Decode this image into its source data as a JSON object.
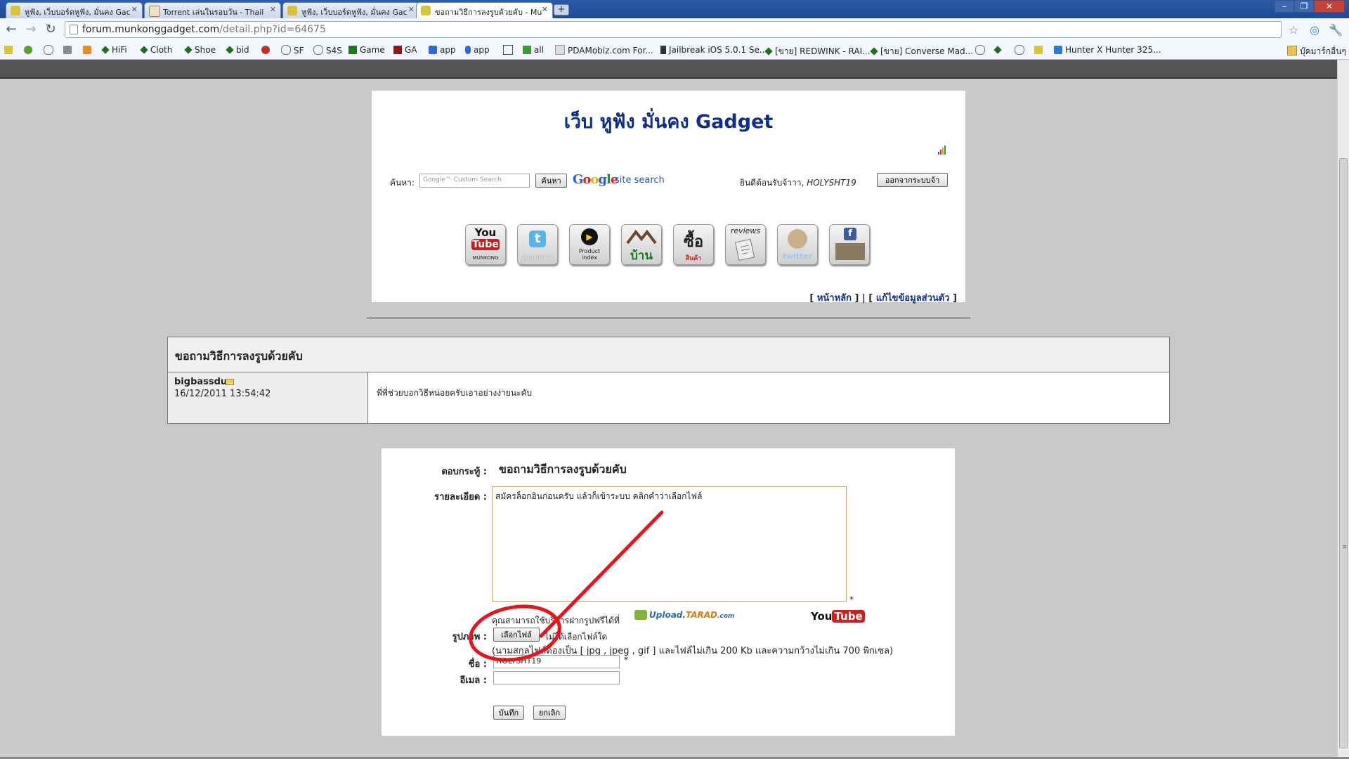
{
  "browser": {
    "tabs": [
      {
        "title": "หูฟัง, เว็บบอร์ดหูฟัง, มั่นคง Gac",
        "active": false
      },
      {
        "title": "Torrent เล่นในรอบวัน - Thail",
        "active": false
      },
      {
        "title": "หูฟัง, เว็บบอร์ดหูฟัง, มั่นคง Gac",
        "active": false
      },
      {
        "title": "ขอถามวิธีการลงรูบด้วยคับ - Mu",
        "active": true
      }
    ],
    "new_tab": "+",
    "url_host": "forum.munkonggadget.com",
    "url_path": "/detail.php?id=64675",
    "bookmarks": [
      "HiFi",
      "Cloth",
      "Shoe",
      "bid",
      "SF",
      "S4S",
      "Game",
      "GA",
      "app",
      "app",
      "all",
      "PDAMobiz.com For...",
      "Jailbreak iOS 5.0.1 Se...",
      "[ขาย] REDWINK - RAI...",
      "[ขาย] Converse Mad...",
      "Hunter X Hunter 325..."
    ],
    "other_bookmarks": "บุ๊คมาร์กอื่นๆ"
  },
  "header": {
    "site_title": "เว็บ หูฟัง มั่นคง Gadget",
    "search_label": "ค้นหา:",
    "search_placeholder": "Google™ Custom Search",
    "search_button": "ค้นหา",
    "google_text": "Google",
    "site_search_text": "site search",
    "welcome_text": "ยินดีต้อนรับจ้าาา,",
    "username": "HOLYSHT19",
    "logout_button": "ออกจากระบบจ้า",
    "nav_icons": [
      {
        "name": "youtube-munkong",
        "line1": "You",
        "line2": "Tube",
        "line3": "MUNKONG"
      },
      {
        "name": "twitter-update",
        "line1": "t",
        "line2": "",
        "line3": "อัพเดทสินค้า"
      },
      {
        "name": "product-index",
        "line1": "▶",
        "line2": "Product",
        "line3": "index"
      },
      {
        "name": "home",
        "line1": "",
        "line2": "บ้าน",
        "line3": ""
      },
      {
        "name": "buy",
        "line1": "ซื้อ",
        "line2": "สินค้า",
        "line3": ""
      },
      {
        "name": "reviews",
        "line1": "reviews",
        "line2": "",
        "line3": ""
      },
      {
        "name": "twitter",
        "line1": "",
        "line2": "",
        "line3": "twitter"
      },
      {
        "name": "facebook",
        "line1": "f",
        "line2": "",
        "line3": ""
      }
    ],
    "links": {
      "home": "หน้าหลัก",
      "edit_profile": "แก้ไขข้อมูลส่วนตัว"
    }
  },
  "topic": {
    "title": "ขอถามวิธีการลงรูบด้วยคับ",
    "author": "bigbassdu",
    "date": "16/12/2011 13:54:42",
    "body": "พี่พี่ช่วยบอกวิธีหน่อยครับเอาอย่างง่ายนะคับ"
  },
  "reply": {
    "topic_label": "ตอบกระทู้ :",
    "topic_value": "ขอถามวิธีการลงรูบด้วยคับ",
    "detail_label": "รายละเอียด :",
    "detail_value": "สมัครล็อกอินก่อนครับ แล้วก็เข้าระบบ คลิกคำว่าเลือกไฟล์",
    "required_mark": "*",
    "upload_note": "คุณสามารถใช้บริการฝากรูปฟรีได้ที่",
    "tarad_logo_a": "Upload.",
    "tarad_logo_b": "TARAD",
    "tarad_logo_c": ".com",
    "youtube_a": "You",
    "youtube_b": "Tube",
    "image_label": "รูปภาพ :",
    "file_button": "เลือกไฟล์",
    "file_status": "ไม่ได้เลือกไฟล์ใด",
    "file_rules": "(นามสกุลไฟล์ต้องเป็น [ jpg , jpeg , gif ] และไฟล์ไม่เกิน 200 Kb และความกว้างไม่เกิน 700 พิกเซล)",
    "name_label": "ชื่อ :",
    "name_value": "HOLYSHT19",
    "email_label": "อีเมล :",
    "email_value": "",
    "save_button": "บันทึก",
    "cancel_button": "ยกเลิก"
  },
  "colors": {
    "site_title": "#0e2d8c",
    "annotation_red": "#e8141c",
    "textarea_border": "#d4a640"
  }
}
